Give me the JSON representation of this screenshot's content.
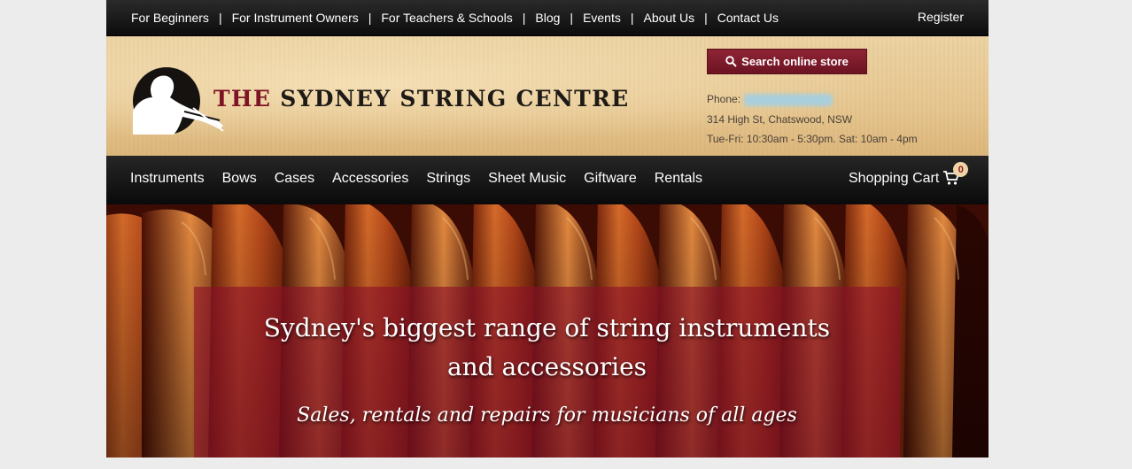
{
  "top_nav": {
    "links": [
      "For Beginners",
      "For Instrument Owners",
      "For Teachers & Schools",
      "Blog",
      "Events",
      "About Us",
      "Contact Us"
    ],
    "register": "Register"
  },
  "header": {
    "logo_the": "THE",
    "logo_rest": "SYDNEY STRING CENTRE",
    "search_label": "Search online store",
    "phone_label": "Phone:",
    "address": "314 High St, Chatswood, NSW",
    "hours": "Tue-Fri: 10:30am - 5:30pm. Sat: 10am - 4pm"
  },
  "main_nav": {
    "items": [
      "Instruments",
      "Bows",
      "Cases",
      "Accessories",
      "Strings",
      "Sheet Music",
      "Giftware",
      "Rentals"
    ],
    "cart_label": "Shopping Cart",
    "cart_count": "0"
  },
  "hero": {
    "title_line1": "Sydney's biggest range of string instruments",
    "title_line2": "and accessories",
    "subtitle": "Sales, rentals and repairs for musicians of all ages"
  },
  "colors": {
    "brand_red": "#7d1426",
    "nav_black": "#0c0c0c",
    "parchment": "#e6c690"
  },
  "icons": [
    "search-icon",
    "shopping-cart-icon",
    "violinist-logo-icon"
  ]
}
